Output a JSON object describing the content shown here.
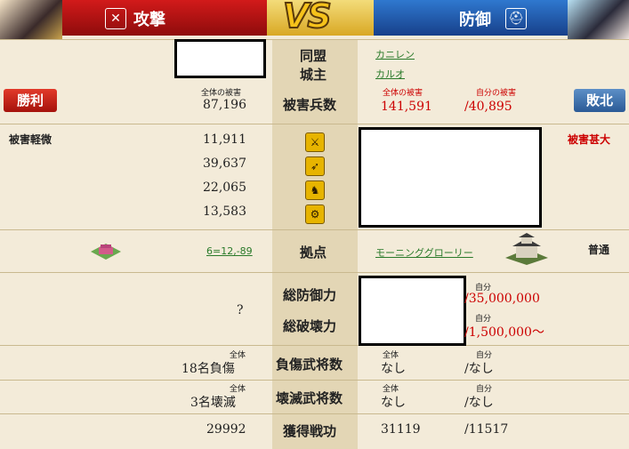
{
  "header": {
    "attack_label": "攻撃",
    "vs_label": "VS",
    "defense_label": "防御"
  },
  "alliance": {
    "label": "同盟",
    "value": "カニレン"
  },
  "lord": {
    "label": "城主",
    "value": "カルオ"
  },
  "casualties": {
    "label": "被害兵数",
    "win_badge": "勝利",
    "lose_badge": "敗北",
    "attacker": {
      "total_caption": "全体の被害",
      "total": "87,196"
    },
    "defender": {
      "total_caption": "全体の被害",
      "total": "141,591",
      "own_caption": "自分の被害",
      "own": "/40,895"
    }
  },
  "damage_status": {
    "attacker": "被害軽微",
    "defender": "被害甚大"
  },
  "units": [
    {
      "icon": "spear-unit-icon",
      "glyph": "⚔",
      "value": "11,911"
    },
    {
      "icon": "bow-unit-icon",
      "glyph": "➶",
      "value": "39,637"
    },
    {
      "icon": "cavalry-unit-icon",
      "glyph": "♞",
      "value": "22,065"
    },
    {
      "icon": "siege-unit-icon",
      "glyph": "⚙",
      "value": "13,583"
    }
  ],
  "base": {
    "label": "拠点",
    "attacker_coord": "6=12,-89",
    "defender_name": "モーニンググローリー",
    "status": "普通"
  },
  "defense_power": {
    "label": "総防御力",
    "own_caption": "自分",
    "own": "/35,000,000"
  },
  "destruction_power": {
    "label": "総破壊力",
    "own_caption": "自分",
    "own": "/1,500,000～"
  },
  "attacker_power_value": "?",
  "injured_generals": {
    "label": "負傷武将数",
    "attacker_caption": "全体",
    "attacker": "18名負傷",
    "total_caption": "全体",
    "total": "なし",
    "own_caption": "自分",
    "own": "/なし"
  },
  "destroyed_generals": {
    "label": "壊滅武将数",
    "attacker_caption": "全体",
    "attacker": "3名壊滅",
    "total_caption": "全体",
    "total": "なし",
    "own_caption": "自分",
    "own": "/なし"
  },
  "merit": {
    "label": "獲得戦功",
    "attacker": "29992",
    "defender": "31119",
    "own": "/11517"
  }
}
